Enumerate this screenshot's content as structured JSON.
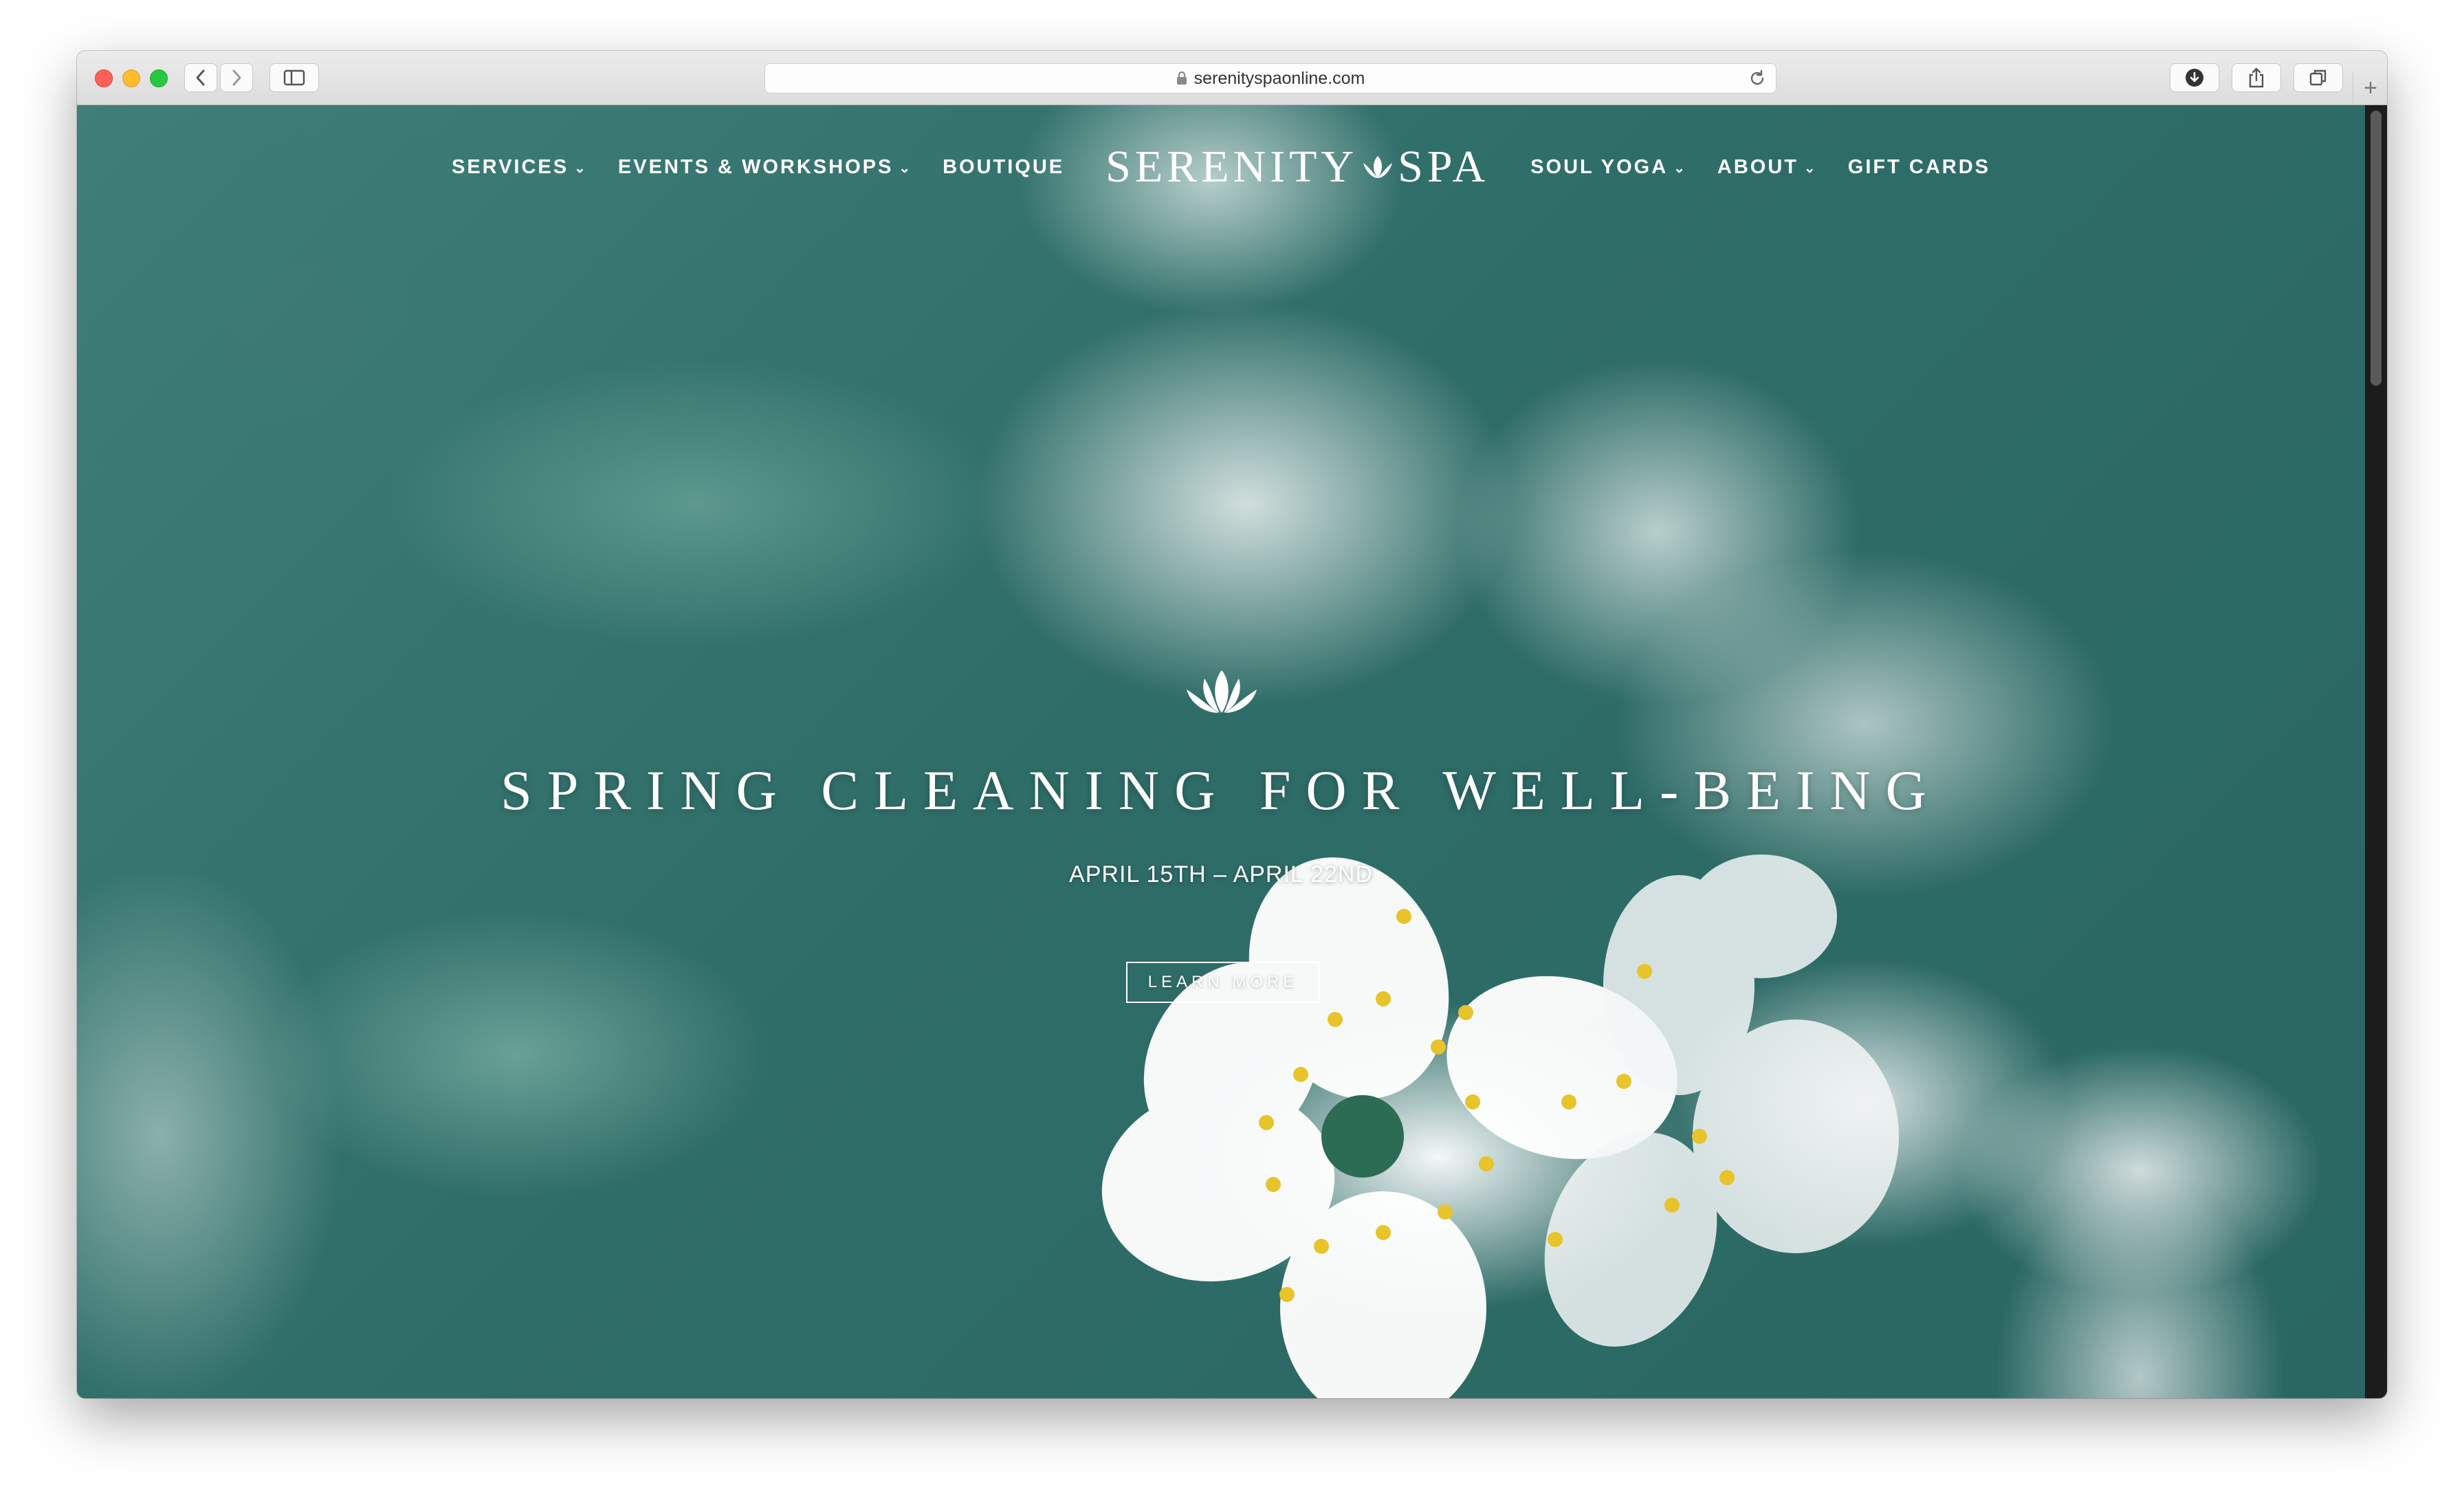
{
  "browser": {
    "url": "serenityspaonline.com",
    "new_tab_label": "+"
  },
  "nav": {
    "items_left": [
      {
        "label": "SERVICES",
        "has_dropdown": true
      },
      {
        "label": "EVENTS & WORKSHOPS",
        "has_dropdown": true
      },
      {
        "label": "BOUTIQUE",
        "has_dropdown": false
      }
    ],
    "logo": {
      "text_left": "SERENITY",
      "text_right": "SPA",
      "icon": "lotus-icon"
    },
    "items_right": [
      {
        "label": "SOUL YOGA",
        "has_dropdown": true
      },
      {
        "label": "ABOUT",
        "has_dropdown": true
      },
      {
        "label": "GIFT CARDS",
        "has_dropdown": false
      }
    ],
    "dropdown_glyph": "⌄"
  },
  "hero": {
    "icon": "lotus-icon",
    "title": "SPRING CLEANING FOR WELL-BEING",
    "dates": "APRIL 15TH – APRIL 22ND",
    "cta_label": "LEARN MORE"
  },
  "colors": {
    "background_teal": "#2f6b67",
    "text": "#ffffff"
  }
}
